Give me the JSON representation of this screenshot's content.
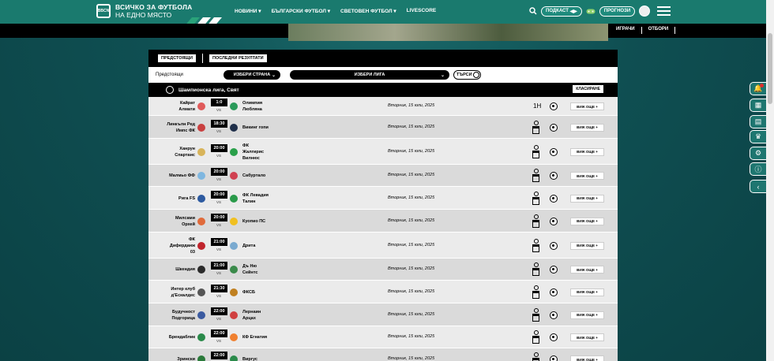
{
  "header": {
    "logo_text": "BBCN",
    "brand_line1": "ВСИЧКО ЗА ФУТБОЛА",
    "brand_line2": "НА ЕДНО МЯСТО",
    "nav": [
      "НОВИНИ",
      "БЪЛГАРСКИ ФУТБОЛ",
      "СВЕТОВЕН ФУТБОЛ",
      "LIVESCORE"
    ],
    "podcast_label": "ПОДКАСТ",
    "forecasts_label": "ПРОГНОЗИ"
  },
  "subnav": {
    "players": "ИГРАЧИ",
    "teams": "ОТБОРИ"
  },
  "tabs": {
    "upcoming": "ПРЕДСТОЯЩИ",
    "results": "ПОСЛЕДНИ РЕЗУЛТАТИ"
  },
  "filters": {
    "label": "Предстоящи",
    "country": "ИЗБЕРИ СТРАНА",
    "league": "ИЗБЕРИ ЛИГА",
    "search": "ТЪРСИ"
  },
  "league": {
    "name": "Шампионска лига, Свят",
    "sort_label": "КЛАСИРАНЕ"
  },
  "matches": [
    {
      "home": [
        "Кайрат",
        "Алмати"
      ],
      "time": "1:0",
      "away": [
        "Олимпия",
        "Любляна"
      ],
      "date": "Вторник, 15 юли, 2025",
      "status": "1H",
      "more": "ВИЖ ОЩЕ +"
    },
    {
      "home": [
        "Линкълн Ред",
        "Импс ФК"
      ],
      "time": "18:30",
      "away": [
        "Викинг гопи"
      ],
      "date": "Вторник, 15 юли, 2025",
      "more": "ВИЖ ОЩЕ +"
    },
    {
      "home": [
        "Ханрун",
        "Спартанс"
      ],
      "time": "20:00",
      "away": [
        "ФК",
        "Жалгирис",
        "Вилнюс"
      ],
      "date": "Вторник, 15 юли, 2025",
      "more": "ВИЖ ОЩЕ +"
    },
    {
      "home": [
        "Малмьо ФФ"
      ],
      "time": "20:00",
      "away": [
        "Сабуртало"
      ],
      "date": "Вторник, 15 юли, 2025",
      "more": "ВИЖ ОЩЕ +"
    },
    {
      "home": [
        "Рига FS"
      ],
      "time": "20:00",
      "away": [
        "ФК Левадия",
        "Талин"
      ],
      "date": "Вторник, 15 юли, 2025",
      "more": "ВИЖ ОЩЕ +"
    },
    {
      "home": [
        "Милсами",
        "Орхей"
      ],
      "time": "20:00",
      "away": [
        "Куопио ПС"
      ],
      "date": "Вторник, 15 юли, 2025",
      "more": "ВИЖ ОЩЕ +"
    },
    {
      "home": [
        "ФК",
        "Диферданж",
        "03"
      ],
      "time": "21:00",
      "away": [
        "Дрита"
      ],
      "date": "Вторник, 15 юли, 2025",
      "more": "ВИЖ ОЩЕ +"
    },
    {
      "home": [
        "Шкендия"
      ],
      "time": "21:00",
      "away": [
        "Дъ Ню",
        "Сейнтс"
      ],
      "date": "Вторник, 15 юли, 2025",
      "more": "ВИЖ ОЩЕ +"
    },
    {
      "home": [
        "Интер клуб",
        "д'Ескалдес"
      ],
      "time": "21:30",
      "away": [
        "ФКСБ"
      ],
      "date": "Вторник, 15 юли, 2025",
      "more": "ВИЖ ОЩЕ +"
    },
    {
      "home": [
        "Будучност",
        "Подгорица"
      ],
      "time": "22:00",
      "away": [
        "Лернаин",
        "Арцах"
      ],
      "date": "Вторник, 15 юли, 2025",
      "more": "ВИЖ ОЩЕ +"
    },
    {
      "home": [
        "Брендаблик"
      ],
      "time": "22:00",
      "away": [
        "КФ Егнатия"
      ],
      "date": "Вторник, 15 юли, 2025",
      "more": "ВИЖ ОЩЕ +"
    },
    {
      "home": [
        "Зрински"
      ],
      "time": "22:00",
      "away": [
        "Виргус"
      ],
      "date": "Вторник, 15 юли, 2025",
      "more": "ВИЖ ОЩЕ +"
    }
  ],
  "colors": {
    "accent": "#1a7a6e",
    "page_bg": "#0f4f52",
    "row_light": "#ebebeb",
    "row_dark": "#dadada"
  }
}
